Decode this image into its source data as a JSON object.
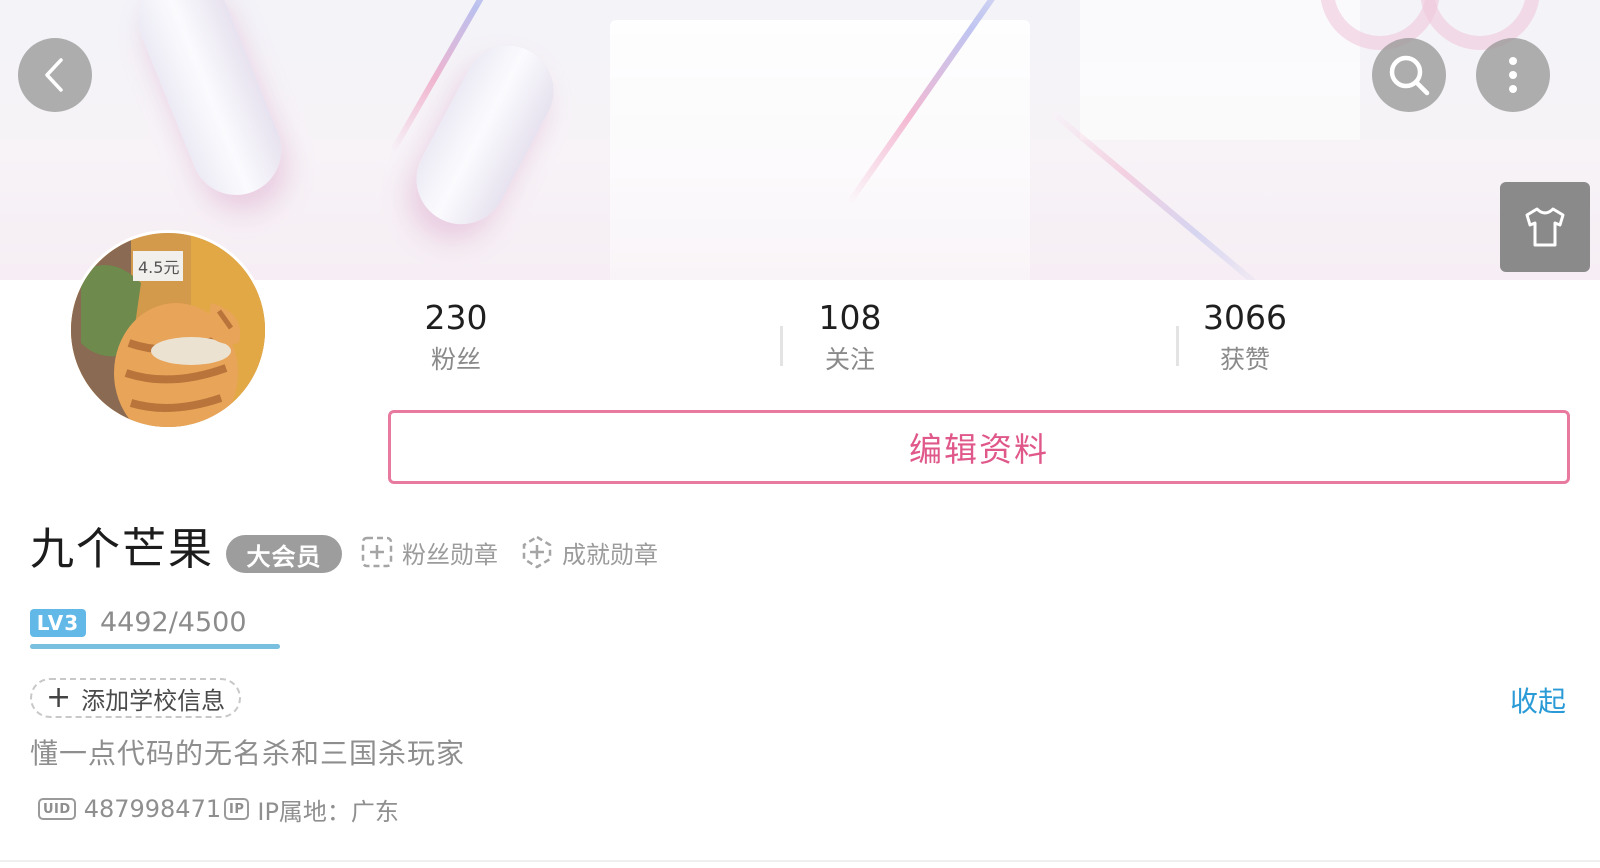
{
  "stats": [
    {
      "value": "230",
      "label": "粉丝"
    },
    {
      "value": "108",
      "label": "关注"
    },
    {
      "value": "3066",
      "label": "获赞"
    }
  ],
  "edit_profile_label": "编辑资料",
  "user": {
    "name": "九个芒果",
    "vip_badge": "大会员",
    "fan_medal_label": "粉丝勋章",
    "achievement_medal_label": "成就勋章",
    "level_tag": "LV3",
    "exp_text": "4492/4500",
    "exp_progress": 0.998,
    "add_school_label": "添加学校信息",
    "collapse_label": "收起",
    "bio": "懂一点代码的无名杀和三国杀玩家",
    "uid_tag": "UID",
    "uid": "487998471",
    "ip_tag": "IP",
    "ip_location": "IP属地：广东"
  },
  "avatar_price_text": "4.5元",
  "colors": {
    "accent_pink": "#e0578a",
    "link_blue": "#2a9bd6",
    "level_blue": "#62b8e6",
    "badge_gray": "#9d9d9d"
  },
  "icons": {
    "back": "chevron-left-icon",
    "search": "search-icon",
    "more": "more-vertical-icon",
    "theme": "tshirt-icon",
    "fan_medal": "add-badge-icon",
    "achievement_medal": "add-achievement-icon"
  }
}
